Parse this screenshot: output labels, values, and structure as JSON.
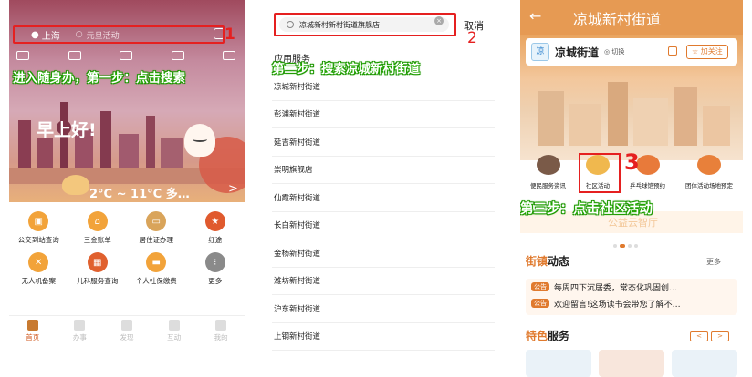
{
  "panel1": {
    "location": "上海",
    "search_placeholder": "元旦活动",
    "marker": "1",
    "step_text": "进入随身办，第一步：点击搜索",
    "greeting": "早上好!",
    "weather": "2°C ~ 11°C 多…",
    "services": [
      {
        "label": "公交到站查询",
        "color": "#f2a33a"
      },
      {
        "label": "三金账单",
        "color": "#f2a33a"
      },
      {
        "label": "居住证办理",
        "color": "#d9a45a"
      },
      {
        "label": "红途",
        "color": "#e05a2e"
      },
      {
        "label": "无人机备案",
        "color": "#f2a33a"
      },
      {
        "label": "儿科服务查询",
        "color": "#e0602e"
      },
      {
        "label": "个人社保缴费",
        "color": "#f2a33a"
      },
      {
        "label": "更多",
        "color": "#8a8a8a"
      }
    ],
    "nav": [
      "首页",
      "办事",
      "发现",
      "互动",
      "我的"
    ]
  },
  "panel2": {
    "search_value": "凉城新村新村街道旗舰店",
    "cancel": "取消",
    "marker": "2",
    "section": "应用服务",
    "step_text": "第二步：搜索凉城新村街道",
    "results": [
      "凉城新村街道",
      "彭浦新村街道",
      "延吉新村街道",
      "崇明旗舰店",
      "仙霞新村街道",
      "长白新村街道",
      "金杨新村街道",
      "潍坊新村街道",
      "沪东新村街道",
      "上钢新村街道"
    ]
  },
  "panel3": {
    "title": "凉城新村街道",
    "card_logo": "凉",
    "card_name": "凉城街道",
    "switch": "◎ 切换",
    "follow": "☆ 加关注",
    "categories": [
      "便民服务资讯",
      "社区活动",
      "乒乓球馆预约",
      "团体活动场地预定"
    ],
    "marker": "3",
    "step_text": "第三步：点击社区活动",
    "banner_text": "公益云智厅",
    "news_title_hl": "街镇",
    "news_title": "动态",
    "more": "更多",
    "news": [
      {
        "tag": "公告",
        "text": "每周四下沉居委，常态化巩固创…"
      },
      {
        "tag": "公告",
        "text": "欢迎留言!这场读书会带您了解不…"
      }
    ],
    "feat_title_hl": "特色",
    "feat_title": "服务",
    "pager": [
      "<",
      ">"
    ]
  }
}
